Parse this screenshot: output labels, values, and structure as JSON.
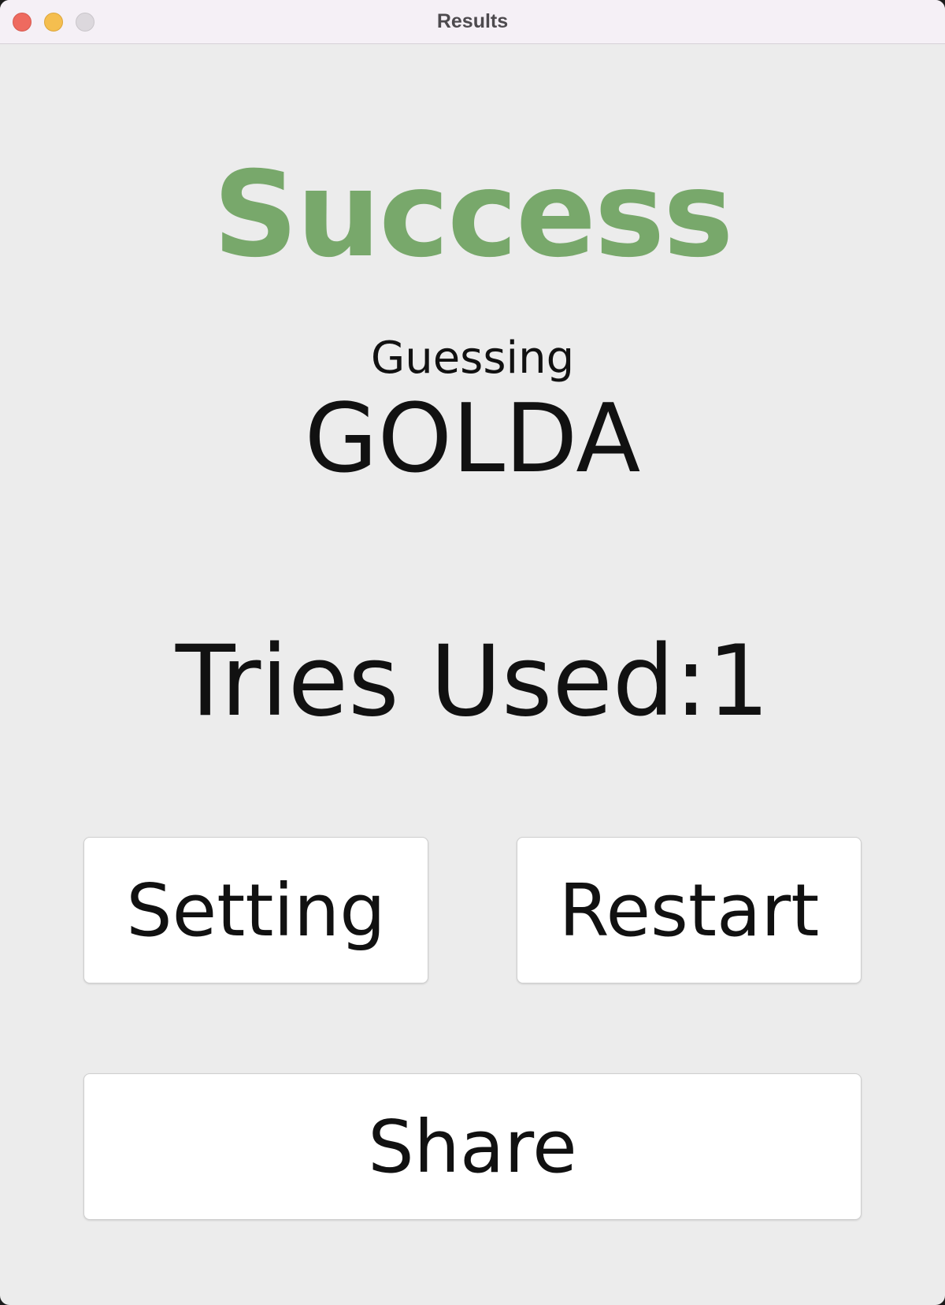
{
  "window": {
    "title": "Results"
  },
  "result": {
    "headline": "Success",
    "headline_color": "#78a86b",
    "guessing_label": "Guessing",
    "answer": "GOLDA",
    "tries_text": "Tries Used:1"
  },
  "buttons": {
    "setting_label": "Setting",
    "restart_label": "Restart",
    "share_label": "Share"
  }
}
